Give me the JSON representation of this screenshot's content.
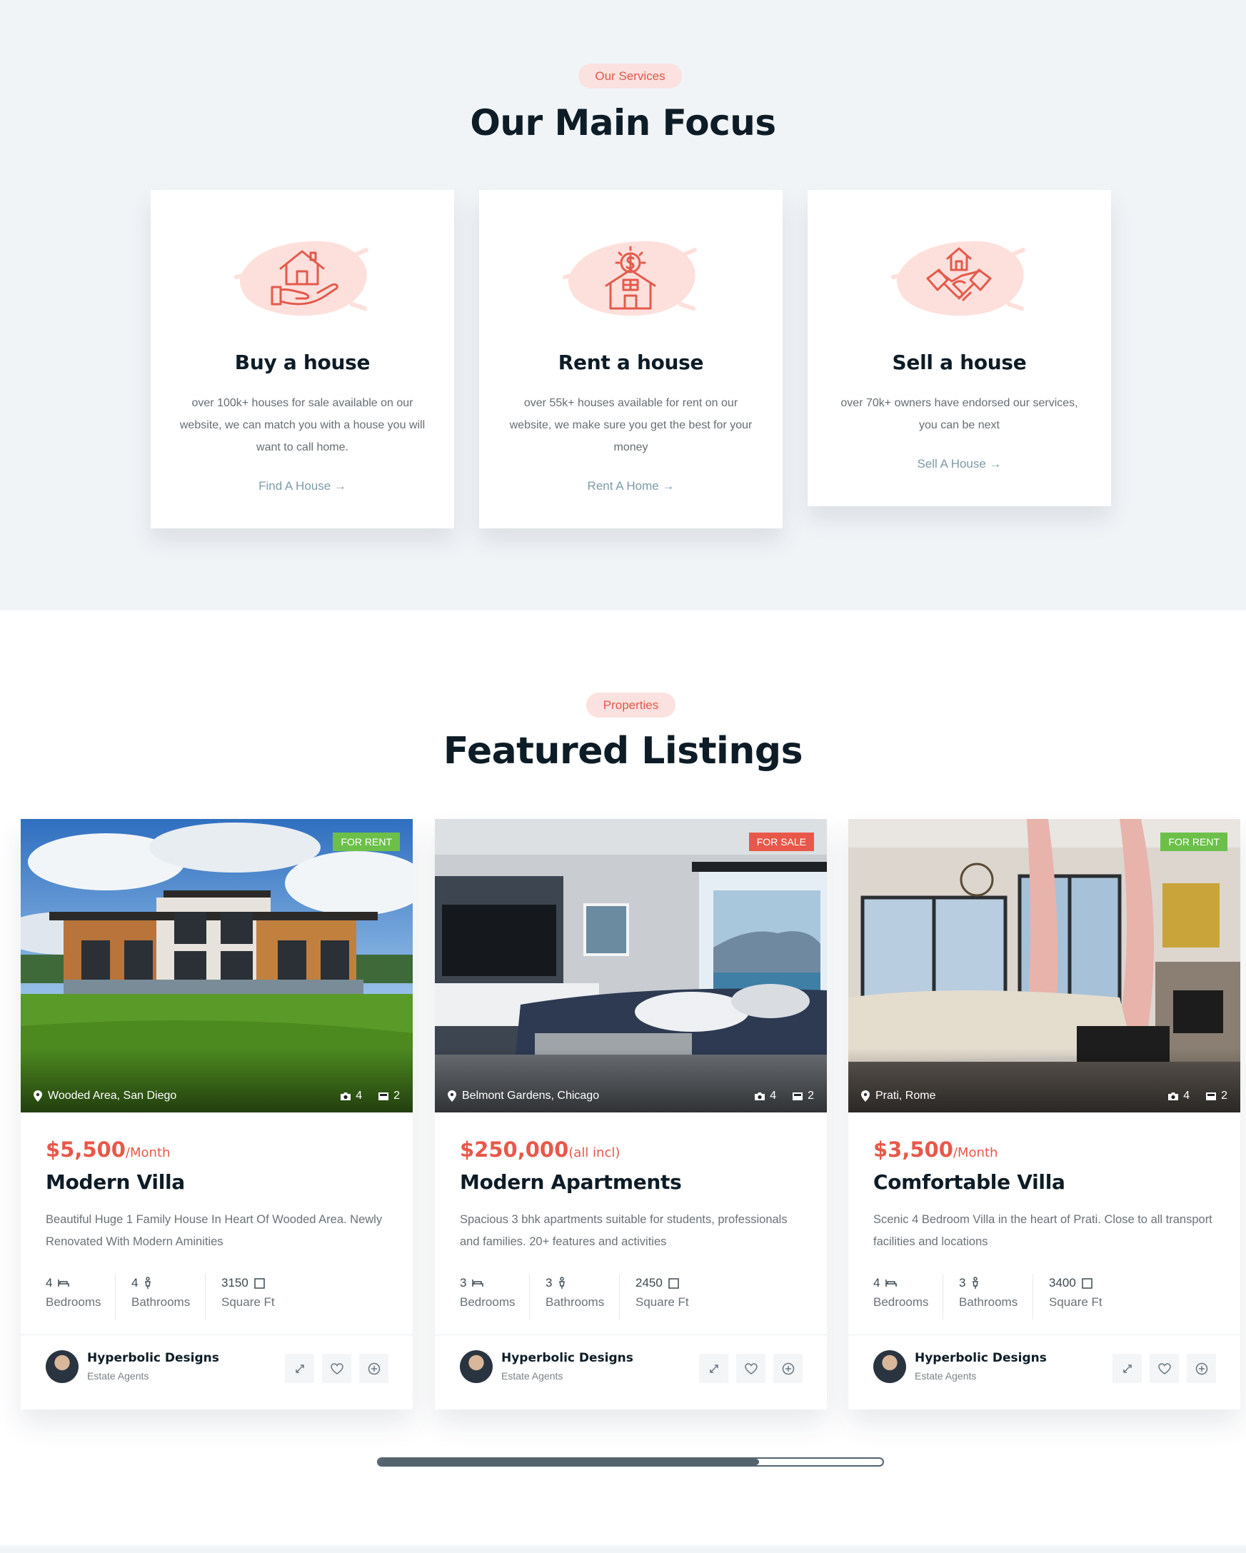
{
  "services": {
    "eyebrow": "Our Services",
    "title": "Our Main Focus",
    "cards": [
      {
        "icon": "house-in-hand-icon",
        "title": "Buy a house",
        "desc": "over 100k+ houses for sale available on our website, we can match you with a house you will want to call home.",
        "link": "Find A House →"
      },
      {
        "icon": "rent-house-dollar-icon",
        "title": "Rent a house",
        "desc": "over 55k+ houses available for rent on our website, we make sure you get the best for your money",
        "link": "Rent A Home →"
      },
      {
        "icon": "handshake-house-icon",
        "title": "Sell a house",
        "desc": "over 70k+ owners have endorsed our services, you can be next",
        "link": "Sell A House →"
      }
    ]
  },
  "listings": {
    "eyebrow": "Properties",
    "title": "Featured Listings",
    "items": [
      {
        "badge": "FOR RENT",
        "badge_color": "#6cc04a",
        "location": "Wooded Area, San Diego",
        "photos": "4",
        "videos": "2",
        "price": "$5,500",
        "price_unit": "/Month",
        "name": "Modern Villa",
        "desc": "Beautiful Huge 1 Family House In Heart Of Wooded Area. Newly Renovated With Modern Aminities",
        "bedrooms": "4",
        "bathrooms": "4",
        "sqft": "3150",
        "bed_label": "Bedrooms",
        "bath_label": "Bathrooms",
        "sqft_label": "Square Ft",
        "agent": "Hyperbolic Designs",
        "agent_role": "Estate Agents"
      },
      {
        "badge": "FOR SALE",
        "badge_color": "#e8584a",
        "location": "Belmont Gardens, Chicago",
        "photos": "4",
        "videos": "2",
        "price": "$250,000",
        "price_unit": "(all incl)",
        "name": "Modern Apartments",
        "desc": "Spacious 3 bhk apartments suitable for students, professionals and families. 20+ features and activities",
        "bedrooms": "3",
        "bathrooms": "3",
        "sqft": "2450",
        "bed_label": "Bedrooms",
        "bath_label": "Bathrooms",
        "sqft_label": "Square Ft",
        "agent": "Hyperbolic Designs",
        "agent_role": "Estate Agents"
      },
      {
        "badge": "FOR RENT",
        "badge_color": "#6cc04a",
        "location": "Prati, Rome",
        "photos": "4",
        "videos": "2",
        "price": "$3,500",
        "price_unit": "/Month",
        "name": "Comfortable Villa",
        "desc": "Scenic 4 Bedroom Villa in the heart of Prati. Close to all transport facilities and locations",
        "bedrooms": "4",
        "bathrooms": "3",
        "sqft": "3400",
        "bed_label": "Bedrooms",
        "bath_label": "Bathrooms",
        "sqft_label": "Square Ft",
        "agent": "Hyperbolic Designs",
        "agent_role": "Estate Agents"
      }
    ],
    "actions": [
      "expand-icon",
      "heart-icon",
      "plus-circle-icon"
    ]
  },
  "carousel": {
    "scroll_position": 0.75
  },
  "colors": {
    "accent": "#e8584a",
    "background": "#f1f4f7",
    "heading": "#0d1c26",
    "link": "#7d9aa6"
  }
}
